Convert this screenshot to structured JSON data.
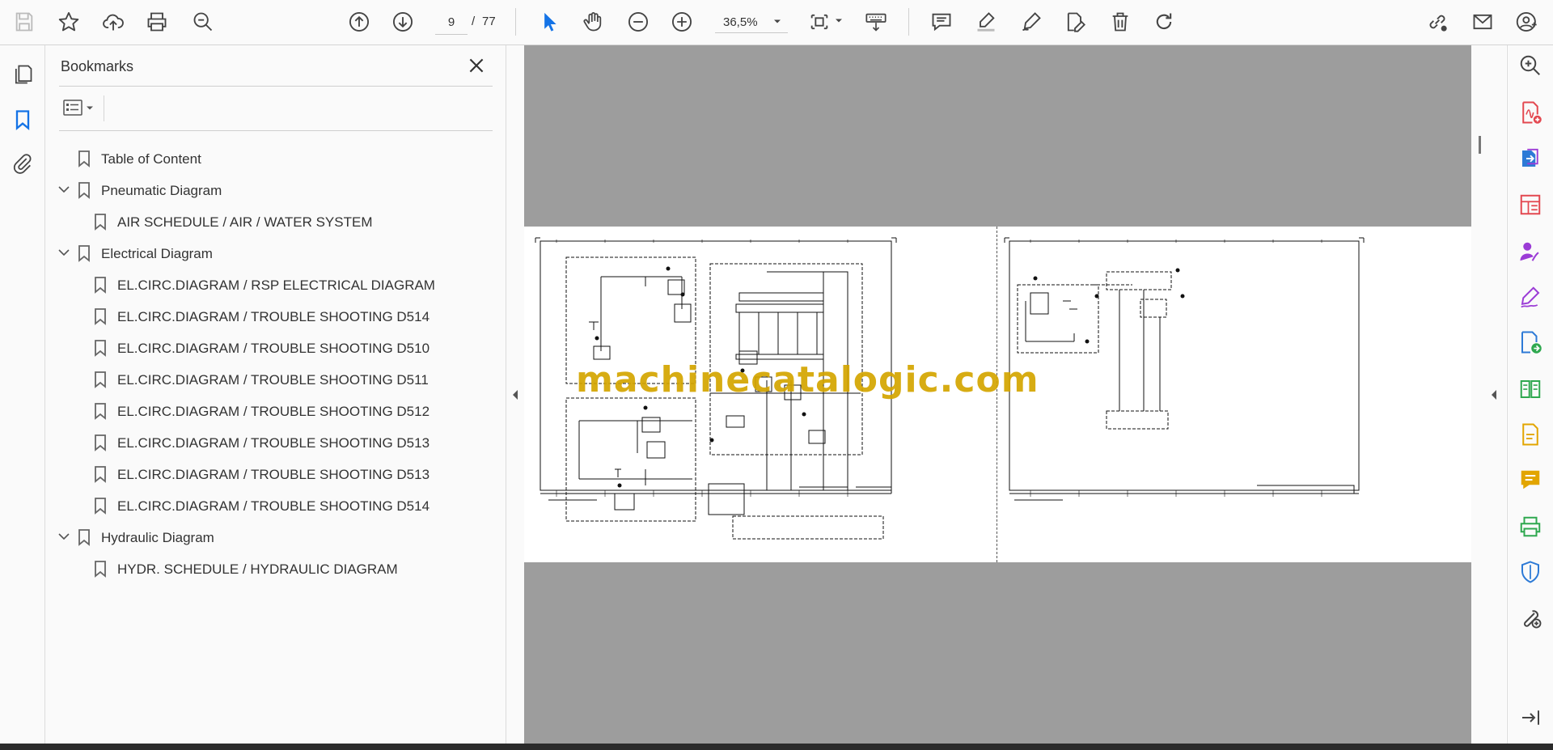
{
  "toolbar": {
    "page_current": "9",
    "page_separator": "/",
    "page_total": "77",
    "zoom": "36,5%"
  },
  "bookmarks": {
    "title": "Bookmarks",
    "items": [
      {
        "label": "Table of Content",
        "level": 0,
        "expandable": false
      },
      {
        "label": "Pneumatic Diagram",
        "level": 0,
        "expandable": true
      },
      {
        "label": "AIR SCHEDULE / AIR / WATER SYSTEM",
        "level": 1,
        "expandable": false
      },
      {
        "label": "Electrical Diagram",
        "level": 0,
        "expandable": true
      },
      {
        "label": "EL.CIRC.DIAGRAM / RSP ELECTRICAL DIAGRAM",
        "level": 1,
        "expandable": false
      },
      {
        "label": "EL.CIRC.DIAGRAM / TROUBLE SHOOTING D514",
        "level": 1,
        "expandable": false
      },
      {
        "label": "EL.CIRC.DIAGRAM / TROUBLE SHOOTING D510",
        "level": 1,
        "expandable": false
      },
      {
        "label": "EL.CIRC.DIAGRAM / TROUBLE SHOOTING D511",
        "level": 1,
        "expandable": false
      },
      {
        "label": "EL.CIRC.DIAGRAM / TROUBLE SHOOTING D512",
        "level": 1,
        "expandable": false
      },
      {
        "label": "EL.CIRC.DIAGRAM / TROUBLE SHOOTING D513",
        "level": 1,
        "expandable": false
      },
      {
        "label": "EL.CIRC.DIAGRAM / TROUBLE SHOOTING D513",
        "level": 1,
        "expandable": false
      },
      {
        "label": "EL.CIRC.DIAGRAM / TROUBLE SHOOTING D514",
        "level": 1,
        "expandable": false
      },
      {
        "label": "Hydraulic Diagram",
        "level": 0,
        "expandable": true
      },
      {
        "label": "HYDR. SCHEDULE / HYDRAULIC DIAGRAM",
        "level": 1,
        "expandable": false
      }
    ]
  },
  "document": {
    "watermark": "machinecatalogic.com"
  },
  "icons": {
    "toolbar": [
      "save-icon",
      "star-icon",
      "upload-icon",
      "print-icon",
      "zoom-search-icon",
      "page-up-icon",
      "page-down-icon",
      "select-cursor-icon",
      "hand-icon",
      "zoom-out-icon",
      "zoom-in-icon",
      "fit-page-icon",
      "keyboard-scroll-icon",
      "comment-icon",
      "highlight-icon",
      "sign-pen-icon",
      "edit-pdf-icon",
      "delete-icon",
      "rotate-icon",
      "share-link-icon",
      "email-icon",
      "account-icon"
    ],
    "right_rail": [
      "search-zoom-icon",
      "create-pdf-icon",
      "export-pdf-icon",
      "organize-pages-icon",
      "request-signature-icon",
      "fill-sign-icon",
      "send-for-review-icon",
      "compare-icon",
      "edit-pdf-icon",
      "comment-icon",
      "print-production-icon",
      "protect-icon",
      "more-tools-icon",
      "collapse-panel-icon"
    ]
  },
  "colors": {
    "accent_blue": "#1473e6",
    "watermark": "#d4a500",
    "doc_background": "#9d9d9d",
    "tool_red": "#e34850",
    "tool_purple": "#9b3cd6",
    "tool_blue": "#2d7ad6",
    "tool_green": "#2fa84f",
    "tool_yellow": "#e2a500"
  }
}
